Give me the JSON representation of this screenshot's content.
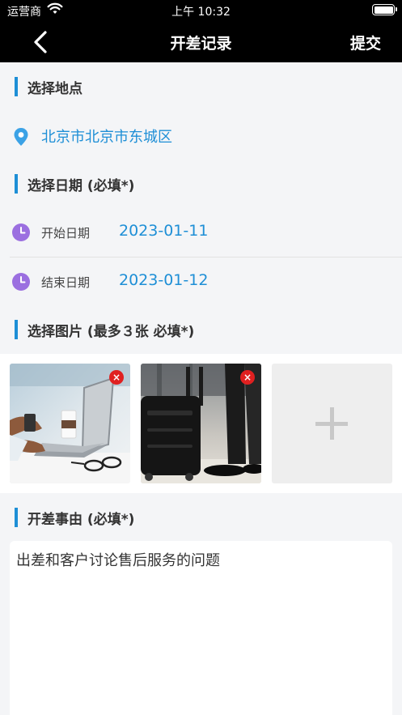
{
  "status_bar": {
    "carrier": "运营商",
    "time": "上午 10:32",
    "icons": [
      "wifi-icon",
      "battery-icon"
    ]
  },
  "nav": {
    "title": "开差记录",
    "submit_label": "提交",
    "back_icon": "chevron-left-icon"
  },
  "location_section": {
    "title": "选择地点",
    "value": "北京市北京市东城区",
    "icon": "location-pin-icon"
  },
  "date_section": {
    "title": "选择日期 (必填*)",
    "start_label": "开始日期",
    "start_value": "2023-01-11",
    "end_label": "结束日期",
    "end_value": "2023-01-12",
    "icon": "clock-icon"
  },
  "photo_section": {
    "title": "选择图片 (最多３张 必填*)",
    "photos": [
      "laptop-photo",
      "luggage-photo"
    ],
    "remove_label": "×",
    "add_icon": "plus-icon"
  },
  "reason_section": {
    "title": "开差事由 (必填*)",
    "value": "出差和客户讨论售后服务的问题"
  },
  "colors": {
    "accent": "#1e8fd6",
    "nav_background": "#000000",
    "page_background": "#f4f5f7",
    "clock_purple": "#9b6fe0",
    "remove_red": "#e02020"
  }
}
